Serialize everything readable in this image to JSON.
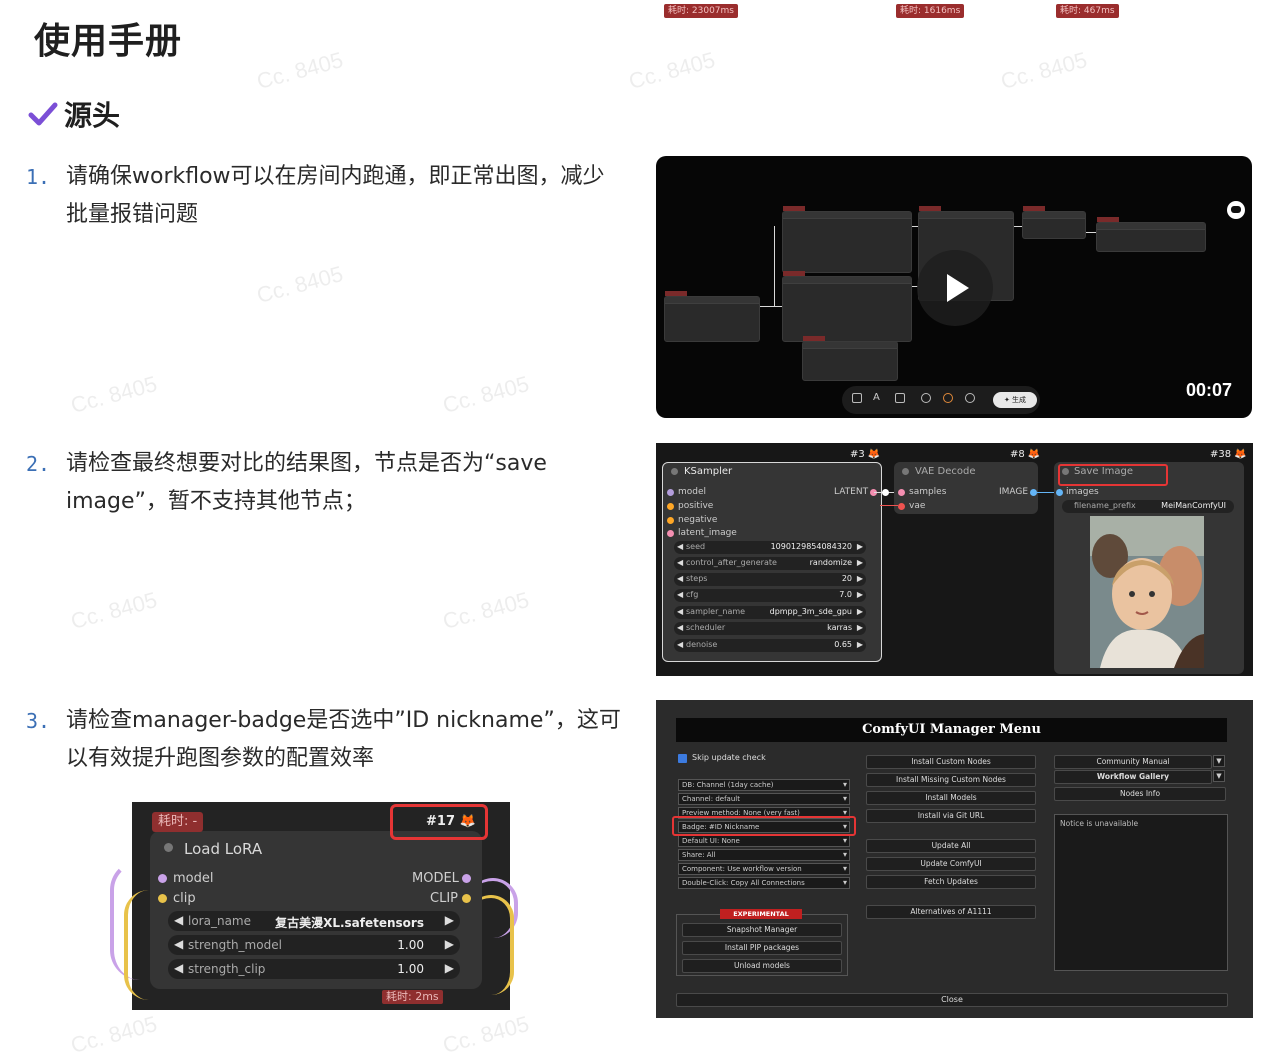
{
  "page": {
    "title": "使用手册",
    "section": "源头",
    "watermark": "Cc. 8405"
  },
  "steps": [
    {
      "num": "1.",
      "text": "请确保workflow可以在房间内跑通，即正常出图，减少批量报错问题"
    },
    {
      "num": "2.",
      "text": "请检查最终想要对比的结果图，节点是否为“save image”，暂不支持其他节点；"
    },
    {
      "num": "3.",
      "text": "请检查manager-badge是否选中”ID nickname”，这可以有效提升跑图参数的配置效率"
    }
  ],
  "video": {
    "duration": "00:07",
    "generate_label": "✦ 生成",
    "icons": [
      "play-icon",
      "chat-icon",
      "cube-icon",
      "text-icon",
      "brush-icon",
      "undo-icon",
      "target-icon",
      "refresh-icon"
    ]
  },
  "graph": {
    "ksampler": {
      "time": "耗时: 23007ms",
      "id": "#3 🦊",
      "title": "KSampler",
      "inputs": [
        "model",
        "positive",
        "negative",
        "latent_image"
      ],
      "output": "LATENT",
      "widgets": [
        {
          "name": "seed",
          "value": "1090129854084320"
        },
        {
          "name": "control_after_generate",
          "value": "randomize"
        },
        {
          "name": "steps",
          "value": "20"
        },
        {
          "name": "cfg",
          "value": "7.0"
        },
        {
          "name": "sampler_name",
          "value": "dpmpp_3m_sde_gpu"
        },
        {
          "name": "scheduler",
          "value": "karras"
        },
        {
          "name": "denoise",
          "value": "0.65"
        }
      ]
    },
    "vae": {
      "time": "耗时: 1616ms",
      "id": "#8 🦊",
      "title": "VAE Decode",
      "inputs": [
        "samples",
        "vae"
      ],
      "output": "IMAGE"
    },
    "save": {
      "time": "耗时: 467ms",
      "id": "#38 🦊",
      "title": "Save Image",
      "input": "images",
      "widget_name": "filename_prefix",
      "widget_value": "MeiManComfyUI"
    }
  },
  "manager": {
    "title": "ComfyUI Manager Menu",
    "skip_update": "Skip update check",
    "selects": [
      "DB: Channel (1day cache)",
      "Channel: default",
      "Preview method: None (very fast)",
      "Badge: #ID Nickname",
      "Default UI: None",
      "Share: All",
      "Component: Use workflow version",
      "Double-Click: Copy All Connections"
    ],
    "experimental": "EXPERIMENTAL",
    "exp_buttons": [
      "Snapshot Manager",
      "Install PIP packages",
      "Unload models"
    ],
    "mid_buttons": [
      "Install Custom Nodes",
      "Install Missing Custom Nodes",
      "Install Models",
      "Install via Git URL"
    ],
    "mid_buttons2": [
      "Update All",
      "Update ComfyUI",
      "Fetch Updates"
    ],
    "alt_button": "Alternatives of A1111",
    "right_buttons": [
      "Community Manual",
      "Workflow Gallery",
      "Nodes Info"
    ],
    "notice": "Notice is unavailable",
    "close": "Close"
  },
  "lora": {
    "time": "耗时: -",
    "id": "#17 🦊",
    "title": "Load LoRA",
    "inputs": [
      "model",
      "clip"
    ],
    "outputs": [
      "MODEL",
      "CLIP"
    ],
    "widgets": [
      {
        "name": "lora_name",
        "value": "复古美漫XL.safetensors"
      },
      {
        "name": "strength_model",
        "value": "1.00"
      },
      {
        "name": "strength_clip",
        "value": "1.00"
      }
    ],
    "bottom_time": "耗时: 2ms"
  },
  "colors": {
    "accent_purple": "#7b4fd6",
    "number_blue": "#3b6fb5",
    "highlight_red": "#e53535"
  }
}
